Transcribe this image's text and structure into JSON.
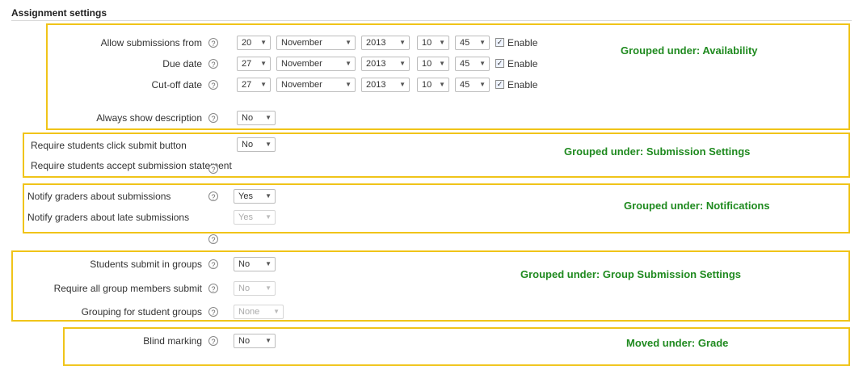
{
  "section_title": "Assignment settings",
  "availability": {
    "group_label": "Grouped under: Availability",
    "rows": [
      {
        "label": "Allow submissions from",
        "day": "20",
        "month": "November",
        "year": "2013",
        "hour": "10",
        "minute": "45",
        "enable_label": "Enable",
        "enabled": true
      },
      {
        "label": "Due date",
        "day": "27",
        "month": "November",
        "year": "2013",
        "hour": "10",
        "minute": "45",
        "enable_label": "Enable",
        "enabled": true
      },
      {
        "label": "Cut-off date",
        "day": "27",
        "month": "November",
        "year": "2013",
        "hour": "10",
        "minute": "45",
        "enable_label": "Enable",
        "enabled": true
      }
    ],
    "always_show_description": {
      "label": "Always show description",
      "value": "No"
    }
  },
  "submission_settings": {
    "group_label": "Grouped under:  Submission Settings",
    "require_click_submit": {
      "label": "Require students click submit button",
      "value": "No"
    },
    "require_accept_statement": {
      "label": "Require students accept submission statement"
    }
  },
  "notifications": {
    "group_label": "Grouped under: Notifications",
    "notify_graders": {
      "label": "Notify graders about submissions",
      "value": "Yes"
    },
    "notify_late": {
      "label": "Notify graders about late submissions",
      "value": "Yes"
    }
  },
  "group_submission": {
    "group_label": "Grouped under:  Group Submission Settings",
    "students_submit_groups": {
      "label": "Students submit in groups",
      "value": "No"
    },
    "require_all_members": {
      "label": "Require all group members submit",
      "value": "No"
    },
    "grouping": {
      "label": "Grouping for student groups",
      "value": "None"
    }
  },
  "grade": {
    "group_label": "Moved under:  Grade",
    "blind_marking": {
      "label": "Blind marking",
      "value": "No"
    }
  },
  "help_icon_glyph": "?",
  "colors": {
    "highlight_border": "#f0c419",
    "group_label": "#1f8a1f"
  }
}
